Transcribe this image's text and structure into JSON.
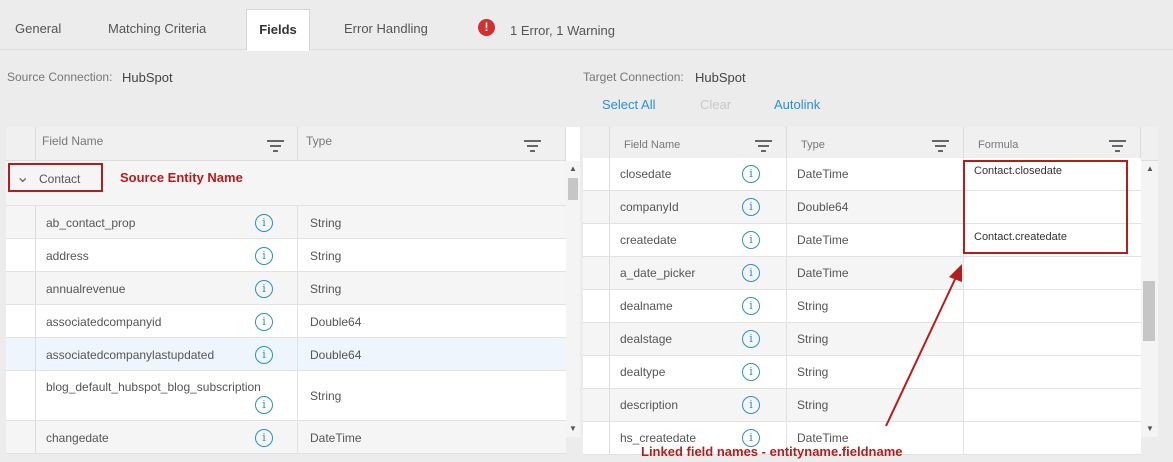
{
  "tabs": [
    {
      "label": "General"
    },
    {
      "label": "Matching Criteria"
    },
    {
      "label": "Fields"
    },
    {
      "label": "Error Handling"
    }
  ],
  "status": {
    "icon": "error-icon",
    "icon_glyph": "!",
    "text": "1 Error, 1 Warning",
    "color": "#d32f2f"
  },
  "source": {
    "conn_label": "Source Connection:",
    "conn_value": "HubSpot",
    "headers": {
      "field": "Field Name",
      "type": "Type"
    },
    "entity": "Contact",
    "rows": [
      {
        "name": "ab_contact_prop",
        "type": "String"
      },
      {
        "name": "address",
        "type": "String"
      },
      {
        "name": "annualrevenue",
        "type": "String"
      },
      {
        "name": "associatedcompanyid",
        "type": "Double64"
      },
      {
        "name": "associatedcompanylastupdated",
        "type": "Double64"
      },
      {
        "name": "blog_default_hubspot_blog_subscription",
        "type": "String"
      },
      {
        "name": "changedate",
        "type": "DateTime"
      }
    ]
  },
  "target": {
    "conn_label": "Target Connection:",
    "conn_value": "HubSpot",
    "actions": {
      "select_all": "Select All",
      "clear": "Clear",
      "autolink": "Autolink"
    },
    "headers": {
      "field": "Field Name",
      "type": "Type",
      "formula": "Formula"
    },
    "rows": [
      {
        "name": "closedate",
        "type": "DateTime",
        "formula": "Contact.closedate"
      },
      {
        "name": "companyId",
        "type": "Double64",
        "formula": ""
      },
      {
        "name": "createdate",
        "type": "DateTime",
        "formula": "Contact.createdate"
      },
      {
        "name": "a_date_picker",
        "type": "DateTime",
        "formula": ""
      },
      {
        "name": "dealname",
        "type": "String",
        "formula": ""
      },
      {
        "name": "dealstage",
        "type": "String",
        "formula": ""
      },
      {
        "name": "dealtype",
        "type": "String",
        "formula": ""
      },
      {
        "name": "description",
        "type": "String",
        "formula": ""
      },
      {
        "name": "hs_createdate",
        "type": "DateTime",
        "formula": ""
      }
    ]
  },
  "annotations": {
    "source_entity": "Source Entity Name",
    "linked": "Linked field names - entityname.fieldname"
  },
  "info_glyph": "i",
  "chevron_glyph": "⌄",
  "scroll_up": "▲",
  "scroll_down": "▼",
  "accent_color": "#2a8fd0",
  "annotation_color": "#b71c1c"
}
